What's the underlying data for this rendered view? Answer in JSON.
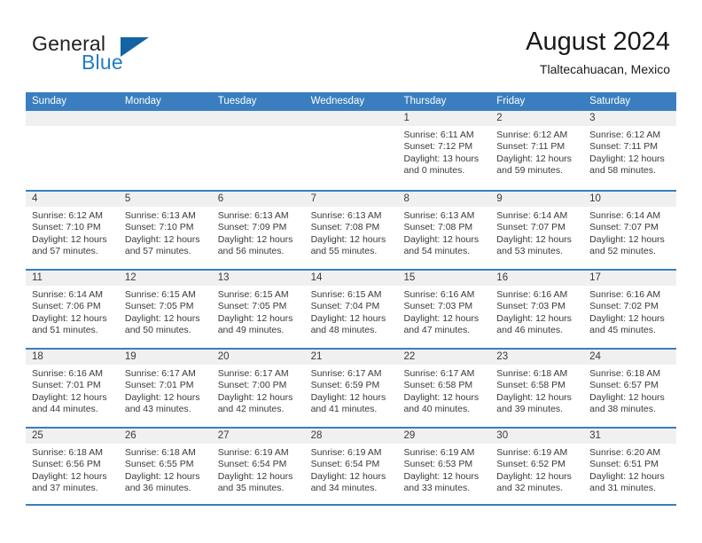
{
  "brand": {
    "word_one": "General",
    "word_two": "Blue",
    "triangle_color": "#1464a5",
    "blue_text_color": "#1f7ec4"
  },
  "header": {
    "title": "August 2024",
    "subtitle": "Tlaltecahuacan, Mexico"
  },
  "theme": {
    "header_blue": "#3a7ebf",
    "daynum_band": "#f0f0f0",
    "text": "#3a3a3a"
  },
  "calendar": {
    "weekdays": [
      "Sunday",
      "Monday",
      "Tuesday",
      "Wednesday",
      "Thursday",
      "Friday",
      "Saturday"
    ],
    "weeks": [
      [
        {
          "day": "",
          "sunrise": "",
          "sunset": "",
          "daylight": ""
        },
        {
          "day": "",
          "sunrise": "",
          "sunset": "",
          "daylight": ""
        },
        {
          "day": "",
          "sunrise": "",
          "sunset": "",
          "daylight": ""
        },
        {
          "day": "",
          "sunrise": "",
          "sunset": "",
          "daylight": ""
        },
        {
          "day": "1",
          "sunrise": "Sunrise: 6:11 AM",
          "sunset": "Sunset: 7:12 PM",
          "daylight": "Daylight: 13 hours and 0 minutes."
        },
        {
          "day": "2",
          "sunrise": "Sunrise: 6:12 AM",
          "sunset": "Sunset: 7:11 PM",
          "daylight": "Daylight: 12 hours and 59 minutes."
        },
        {
          "day": "3",
          "sunrise": "Sunrise: 6:12 AM",
          "sunset": "Sunset: 7:11 PM",
          "daylight": "Daylight: 12 hours and 58 minutes."
        }
      ],
      [
        {
          "day": "4",
          "sunrise": "Sunrise: 6:12 AM",
          "sunset": "Sunset: 7:10 PM",
          "daylight": "Daylight: 12 hours and 57 minutes."
        },
        {
          "day": "5",
          "sunrise": "Sunrise: 6:13 AM",
          "sunset": "Sunset: 7:10 PM",
          "daylight": "Daylight: 12 hours and 57 minutes."
        },
        {
          "day": "6",
          "sunrise": "Sunrise: 6:13 AM",
          "sunset": "Sunset: 7:09 PM",
          "daylight": "Daylight: 12 hours and 56 minutes."
        },
        {
          "day": "7",
          "sunrise": "Sunrise: 6:13 AM",
          "sunset": "Sunset: 7:08 PM",
          "daylight": "Daylight: 12 hours and 55 minutes."
        },
        {
          "day": "8",
          "sunrise": "Sunrise: 6:13 AM",
          "sunset": "Sunset: 7:08 PM",
          "daylight": "Daylight: 12 hours and 54 minutes."
        },
        {
          "day": "9",
          "sunrise": "Sunrise: 6:14 AM",
          "sunset": "Sunset: 7:07 PM",
          "daylight": "Daylight: 12 hours and 53 minutes."
        },
        {
          "day": "10",
          "sunrise": "Sunrise: 6:14 AM",
          "sunset": "Sunset: 7:07 PM",
          "daylight": "Daylight: 12 hours and 52 minutes."
        }
      ],
      [
        {
          "day": "11",
          "sunrise": "Sunrise: 6:14 AM",
          "sunset": "Sunset: 7:06 PM",
          "daylight": "Daylight: 12 hours and 51 minutes."
        },
        {
          "day": "12",
          "sunrise": "Sunrise: 6:15 AM",
          "sunset": "Sunset: 7:05 PM",
          "daylight": "Daylight: 12 hours and 50 minutes."
        },
        {
          "day": "13",
          "sunrise": "Sunrise: 6:15 AM",
          "sunset": "Sunset: 7:05 PM",
          "daylight": "Daylight: 12 hours and 49 minutes."
        },
        {
          "day": "14",
          "sunrise": "Sunrise: 6:15 AM",
          "sunset": "Sunset: 7:04 PM",
          "daylight": "Daylight: 12 hours and 48 minutes."
        },
        {
          "day": "15",
          "sunrise": "Sunrise: 6:16 AM",
          "sunset": "Sunset: 7:03 PM",
          "daylight": "Daylight: 12 hours and 47 minutes."
        },
        {
          "day": "16",
          "sunrise": "Sunrise: 6:16 AM",
          "sunset": "Sunset: 7:03 PM",
          "daylight": "Daylight: 12 hours and 46 minutes."
        },
        {
          "day": "17",
          "sunrise": "Sunrise: 6:16 AM",
          "sunset": "Sunset: 7:02 PM",
          "daylight": "Daylight: 12 hours and 45 minutes."
        }
      ],
      [
        {
          "day": "18",
          "sunrise": "Sunrise: 6:16 AM",
          "sunset": "Sunset: 7:01 PM",
          "daylight": "Daylight: 12 hours and 44 minutes."
        },
        {
          "day": "19",
          "sunrise": "Sunrise: 6:17 AM",
          "sunset": "Sunset: 7:01 PM",
          "daylight": "Daylight: 12 hours and 43 minutes."
        },
        {
          "day": "20",
          "sunrise": "Sunrise: 6:17 AM",
          "sunset": "Sunset: 7:00 PM",
          "daylight": "Daylight: 12 hours and 42 minutes."
        },
        {
          "day": "21",
          "sunrise": "Sunrise: 6:17 AM",
          "sunset": "Sunset: 6:59 PM",
          "daylight": "Daylight: 12 hours and 41 minutes."
        },
        {
          "day": "22",
          "sunrise": "Sunrise: 6:17 AM",
          "sunset": "Sunset: 6:58 PM",
          "daylight": "Daylight: 12 hours and 40 minutes."
        },
        {
          "day": "23",
          "sunrise": "Sunrise: 6:18 AM",
          "sunset": "Sunset: 6:58 PM",
          "daylight": "Daylight: 12 hours and 39 minutes."
        },
        {
          "day": "24",
          "sunrise": "Sunrise: 6:18 AM",
          "sunset": "Sunset: 6:57 PM",
          "daylight": "Daylight: 12 hours and 38 minutes."
        }
      ],
      [
        {
          "day": "25",
          "sunrise": "Sunrise: 6:18 AM",
          "sunset": "Sunset: 6:56 PM",
          "daylight": "Daylight: 12 hours and 37 minutes."
        },
        {
          "day": "26",
          "sunrise": "Sunrise: 6:18 AM",
          "sunset": "Sunset: 6:55 PM",
          "daylight": "Daylight: 12 hours and 36 minutes."
        },
        {
          "day": "27",
          "sunrise": "Sunrise: 6:19 AM",
          "sunset": "Sunset: 6:54 PM",
          "daylight": "Daylight: 12 hours and 35 minutes."
        },
        {
          "day": "28",
          "sunrise": "Sunrise: 6:19 AM",
          "sunset": "Sunset: 6:54 PM",
          "daylight": "Daylight: 12 hours and 34 minutes."
        },
        {
          "day": "29",
          "sunrise": "Sunrise: 6:19 AM",
          "sunset": "Sunset: 6:53 PM",
          "daylight": "Daylight: 12 hours and 33 minutes."
        },
        {
          "day": "30",
          "sunrise": "Sunrise: 6:19 AM",
          "sunset": "Sunset: 6:52 PM",
          "daylight": "Daylight: 12 hours and 32 minutes."
        },
        {
          "day": "31",
          "sunrise": "Sunrise: 6:20 AM",
          "sunset": "Sunset: 6:51 PM",
          "daylight": "Daylight: 12 hours and 31 minutes."
        }
      ]
    ]
  }
}
